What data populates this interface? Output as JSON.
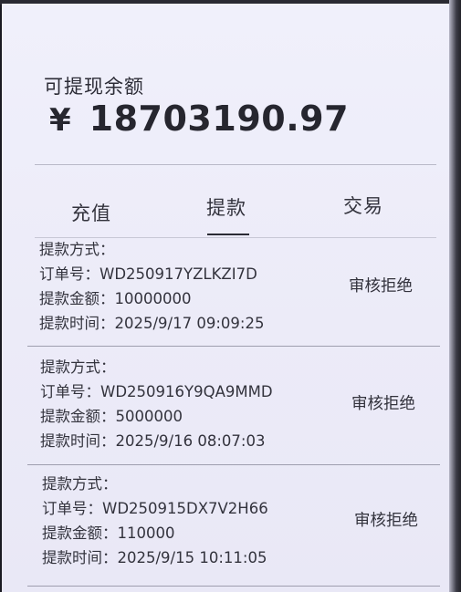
{
  "balance": {
    "label": "可提现余额",
    "currency": "¥",
    "amount": "18703190.97"
  },
  "tabs": [
    {
      "label": "充值",
      "active": false
    },
    {
      "label": "提款",
      "active": true
    },
    {
      "label": "交易",
      "active": false
    }
  ],
  "records": [
    {
      "method": "提款方式：",
      "order": "订单号：WD250917YZLKZI7D",
      "amount": "提款金额：10000000",
      "time": "提款时间：2025/9/17 09:09:25",
      "status": "审核拒绝"
    },
    {
      "method": "提款方式：",
      "order": "订单号：WD250916Y9QA9MMD",
      "amount": "提款金额：5000000",
      "time": "提款时间：2025/9/16 08:07:03",
      "status": "审核拒绝"
    },
    {
      "method": "提款方式：",
      "order": "订单号：WD250915DX7V2H66",
      "amount": "提款金额：110000",
      "time": "提款时间：2025/9/15 10:11:05",
      "status": "审核拒绝"
    }
  ]
}
